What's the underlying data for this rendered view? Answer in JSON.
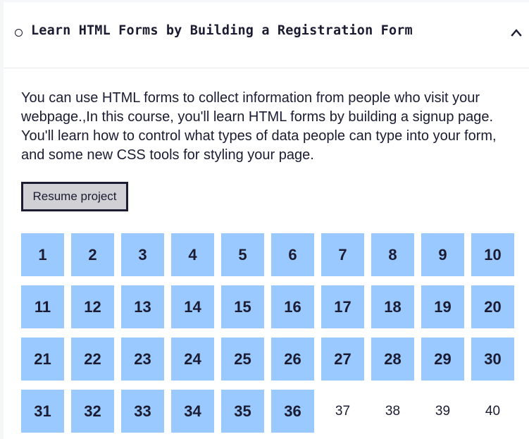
{
  "block": {
    "title": "Learn HTML Forms by Building a Registration Form",
    "status_icon": "circle-icon",
    "toggle_icon": "chevron-up-icon",
    "description": "You can use HTML forms to collect information from people who visit your webpage.,In this course, you'll learn HTML forms by building a signup page. You'll learn how to control what types of data people can type into your form, and some new CSS tools for styling your page.",
    "resume_label": "Resume project"
  },
  "colors": {
    "text": "#1b1b32",
    "completed_step": "#99c9ff",
    "button_bg": "#d0d0d5"
  },
  "steps": [
    {
      "label": "1",
      "completed": true
    },
    {
      "label": "2",
      "completed": true
    },
    {
      "label": "3",
      "completed": true
    },
    {
      "label": "4",
      "completed": true
    },
    {
      "label": "5",
      "completed": true
    },
    {
      "label": "6",
      "completed": true
    },
    {
      "label": "7",
      "completed": true
    },
    {
      "label": "8",
      "completed": true
    },
    {
      "label": "9",
      "completed": true
    },
    {
      "label": "10",
      "completed": true
    },
    {
      "label": "11",
      "completed": true
    },
    {
      "label": "12",
      "completed": true
    },
    {
      "label": "13",
      "completed": true
    },
    {
      "label": "14",
      "completed": true
    },
    {
      "label": "15",
      "completed": true
    },
    {
      "label": "16",
      "completed": true
    },
    {
      "label": "17",
      "completed": true
    },
    {
      "label": "18",
      "completed": true
    },
    {
      "label": "19",
      "completed": true
    },
    {
      "label": "20",
      "completed": true
    },
    {
      "label": "21",
      "completed": true
    },
    {
      "label": "22",
      "completed": true
    },
    {
      "label": "23",
      "completed": true
    },
    {
      "label": "24",
      "completed": true
    },
    {
      "label": "25",
      "completed": true
    },
    {
      "label": "26",
      "completed": true
    },
    {
      "label": "27",
      "completed": true
    },
    {
      "label": "28",
      "completed": true
    },
    {
      "label": "29",
      "completed": true
    },
    {
      "label": "30",
      "completed": true
    },
    {
      "label": "31",
      "completed": true
    },
    {
      "label": "32",
      "completed": true
    },
    {
      "label": "33",
      "completed": true
    },
    {
      "label": "34",
      "completed": true
    },
    {
      "label": "35",
      "completed": true
    },
    {
      "label": "36",
      "completed": true
    },
    {
      "label": "37",
      "completed": false
    },
    {
      "label": "38",
      "completed": false
    },
    {
      "label": "39",
      "completed": false
    },
    {
      "label": "40",
      "completed": false
    }
  ]
}
